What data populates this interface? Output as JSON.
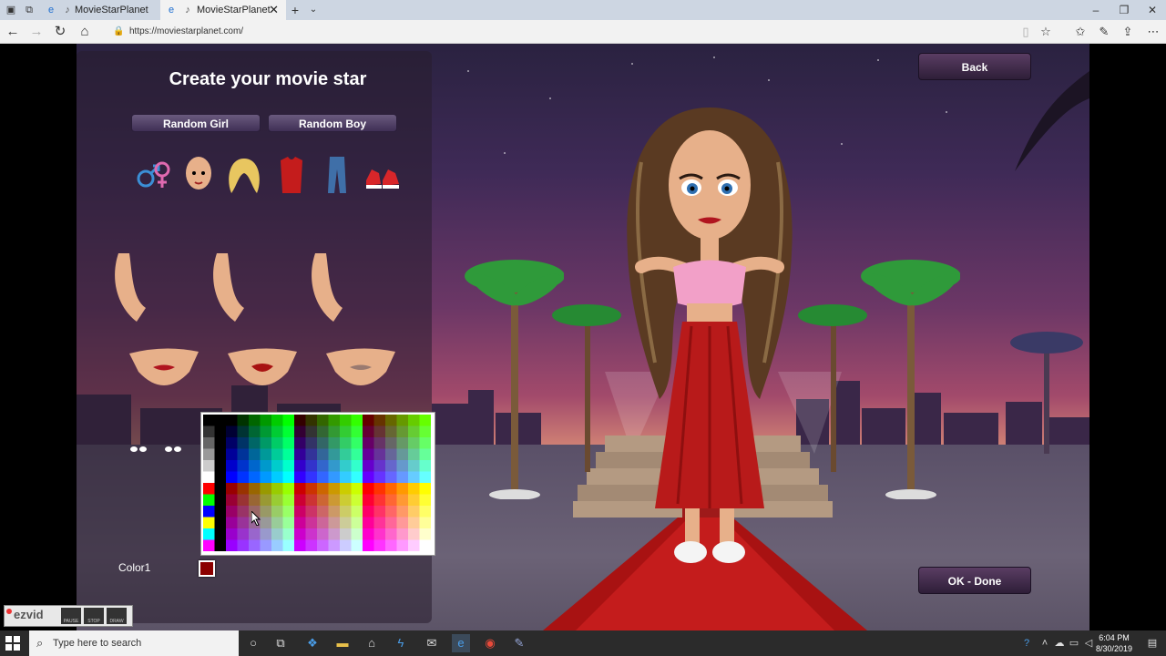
{
  "browser": {
    "tabs": [
      {
        "label": "MovieStarPlanet",
        "active": false
      },
      {
        "label": "MovieStarPlanet",
        "active": true
      }
    ],
    "url": "https://moviestarplanet.com/",
    "close_glyph": "✕",
    "new_tab_glyph": "+"
  },
  "game": {
    "title": "Create your movie star",
    "random_girl_label": "Random Girl",
    "random_boy_label": "Random Boy",
    "categories": [
      "gender",
      "face",
      "hair",
      "top",
      "bottom",
      "shoes"
    ],
    "back_label": "Back",
    "ok_label": "OK - Done",
    "color_label": "Color1",
    "selected_color": "#8b0000",
    "palette_grays": [
      "#000000",
      "#333333",
      "#666666",
      "#999999",
      "#cccccc",
      "#ffffff"
    ],
    "palette_primaries": [
      "#ff0000",
      "#00ff00",
      "#0000ff",
      "#ffff00",
      "#00ffff",
      "#ff00ff"
    ]
  },
  "ezvid": {
    "logo": "ezvid",
    "sub": "RECORDER",
    "controls": [
      "PAUSE",
      "STOP",
      "DRAW"
    ]
  },
  "taskbar": {
    "search_placeholder": "Type here to search",
    "time": "6:04 PM",
    "date": "8/30/2019"
  },
  "colors": {
    "accent_button": "#3f2f55",
    "tab_active_bg": "#f2f2f2",
    "tabbar_bg": "#cdd6e2",
    "taskbar_bg": "#2b2b2b"
  }
}
